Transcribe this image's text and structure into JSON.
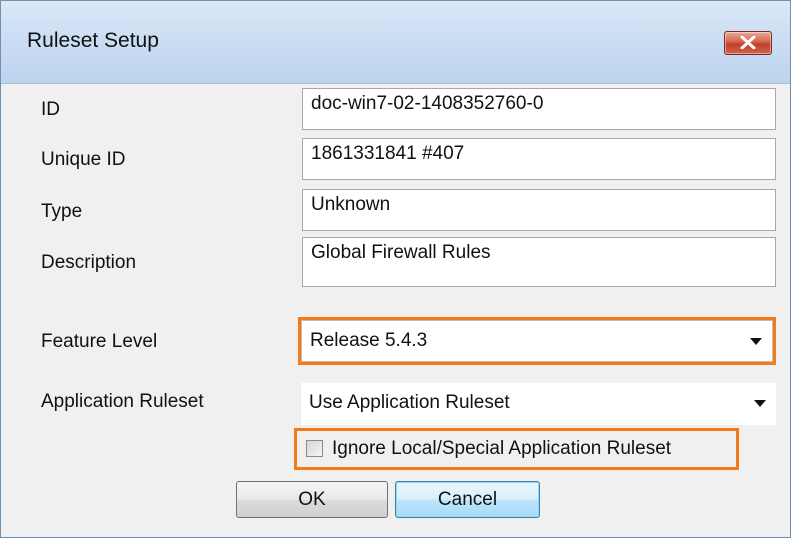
{
  "window": {
    "title": "Ruleset Setup"
  },
  "icons": {
    "close": "close-icon",
    "dropdown": "chevron-down-icon"
  },
  "fields": {
    "id": {
      "label": "ID",
      "value": "doc-win7-02-1408352760-0"
    },
    "unique_id": {
      "label": "Unique ID",
      "value": "1861331841 #407"
    },
    "type": {
      "label": "Type",
      "value": "Unknown"
    },
    "description": {
      "label": "Description",
      "value": "Global Firewall Rules"
    }
  },
  "feature_level": {
    "label": "Feature Level",
    "selected": "Release 5.4.3"
  },
  "application_ruleset": {
    "label": "Application Ruleset",
    "selected": "Use Application Ruleset"
  },
  "ignore_local": {
    "label": "Ignore Local/Special Application Ruleset",
    "checked": false
  },
  "buttons": {
    "ok": "OK",
    "cancel": "Cancel"
  },
  "colors": {
    "highlight": "#f07c1e",
    "close_button": "#c3402a"
  }
}
